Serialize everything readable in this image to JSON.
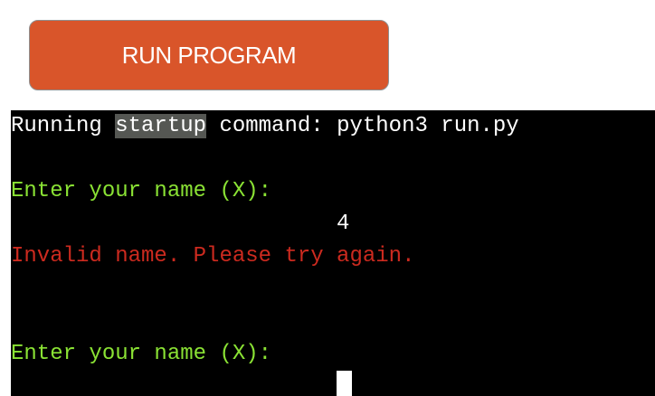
{
  "button": {
    "label": "RUN PROGRAM"
  },
  "terminal": {
    "startup_prefix": "Running ",
    "startup_highlight": "startup",
    "startup_suffix": " command: python3 run.py",
    "prompt_1": "Enter your name (X):",
    "input_1": "4",
    "error": "Invalid name. Please try again.",
    "prompt_2": "Enter your name (X):"
  },
  "colors": {
    "button_bg": "#d9552a",
    "terminal_bg": "#000000",
    "prompt_green": "#8ae234",
    "error_red": "#cc2a1f",
    "highlight_bg": "#555753"
  }
}
